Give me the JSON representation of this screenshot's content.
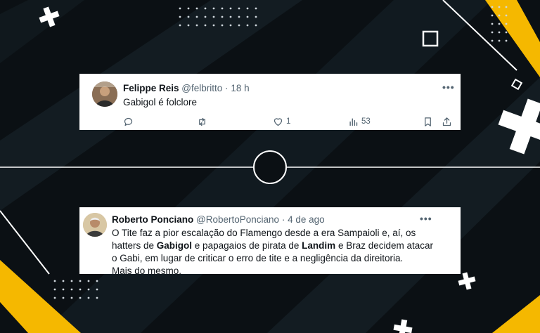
{
  "colors": {
    "background": "#0b1014",
    "accent": "#f5b800",
    "card": "#ffffff",
    "text_primary": "#0f1419",
    "text_secondary": "#536471"
  },
  "tweets": [
    {
      "author": "Felippe Reis",
      "handle": "@felbritto",
      "separator": "·",
      "time": "18 h",
      "text": "Gabigol é folclore",
      "more_label": "•••",
      "actions": {
        "reply_icon": "reply-icon",
        "retweet_icon": "retweet-icon",
        "like_icon": "heart-icon",
        "likes": "1",
        "views_icon": "views-icon",
        "views": "53",
        "bookmark_icon": "bookmark-icon",
        "share_icon": "share-icon"
      }
    },
    {
      "author": "Roberto Ponciano",
      "handle": "@RobertoPonciano",
      "separator": "·",
      "time": "4 de ago",
      "more_label": "•••",
      "text_parts": {
        "l1": "O Tite faz a pior escalação do Flamengo desde a era Sampaioli e, aí, os",
        "l2a": "hatters de ",
        "l2b": "Gabigol",
        "l2c": " e papagaios de pirata de ",
        "l2d": "Landim",
        "l2e": " e Braz decidem atacar",
        "l3": "o Gabi, em lugar de criticar o erro de tite e a negligência da direitoria.",
        "l4": "Mais do mesmo."
      }
    }
  ],
  "decorations": {
    "plus_icons": [
      "plus-icon",
      "plus-icon",
      "plus-icon",
      "plus-icon"
    ],
    "square_icon": "square-outline-icon",
    "center_circle": "circle-outline-icon"
  }
}
